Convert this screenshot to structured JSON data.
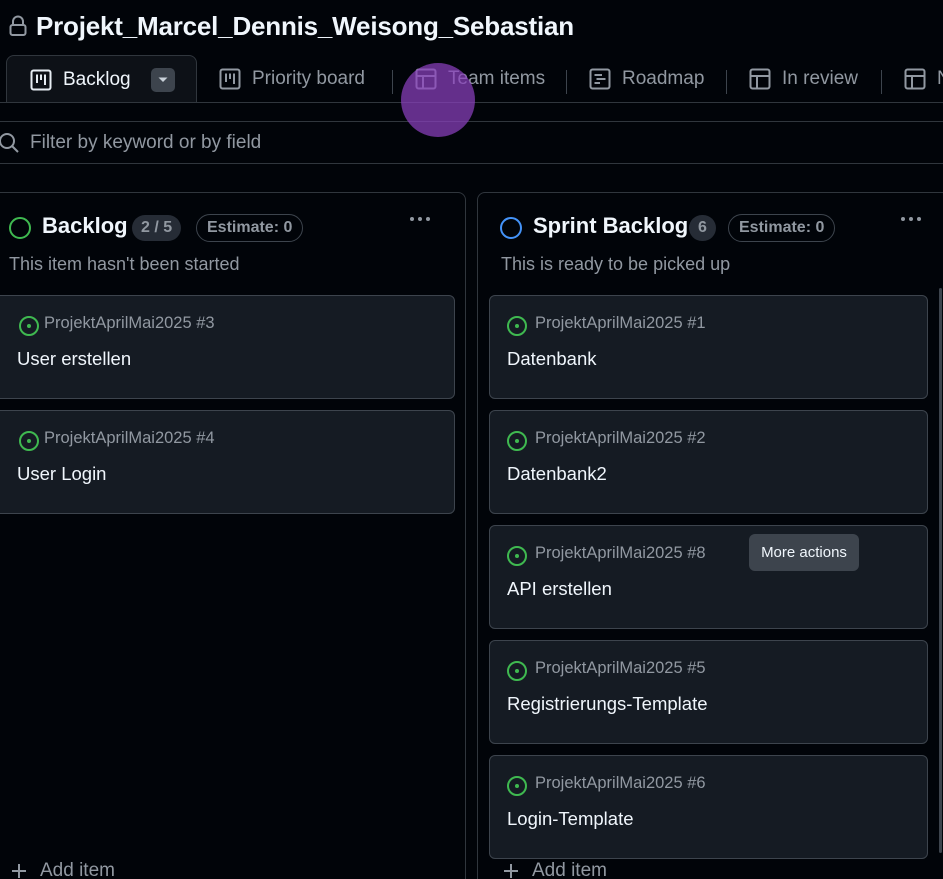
{
  "project": {
    "title": "Projekt_Marcel_Dennis_Weisong_Sebastian"
  },
  "tabs": [
    {
      "label": "Backlog",
      "icon": "board-icon",
      "active": true
    },
    {
      "label": "Priority board",
      "icon": "board-icon"
    },
    {
      "label": "Team items",
      "icon": "table-icon"
    },
    {
      "label": "Roadmap",
      "icon": "roadmap-icon"
    },
    {
      "label": "In review",
      "icon": "table-icon"
    },
    {
      "label": "N",
      "icon": "table-icon"
    }
  ],
  "filter": {
    "placeholder": "Filter by keyword or by field",
    "value": ""
  },
  "columns": [
    {
      "title": "Backlog",
      "count": "2 / 5",
      "estimate": "Estimate: 0",
      "description": "This item hasn't been started",
      "status_color": "#3fb950",
      "cards": [
        {
          "repo": "ProjektAprilMai2025 #3",
          "title": "User erstellen"
        },
        {
          "repo": "ProjektAprilMai2025 #4",
          "title": "User Login"
        }
      ],
      "add_item": "Add item"
    },
    {
      "title": "Sprint Backlog",
      "count": "6",
      "estimate": "Estimate: 0",
      "description": "This is ready to be picked up",
      "status_color": "#4493f8",
      "cards": [
        {
          "repo": "ProjektAprilMai2025 #1",
          "title": "Datenbank"
        },
        {
          "repo": "ProjektAprilMai2025 #2",
          "title": "Datenbank2"
        },
        {
          "repo": "ProjektAprilMai2025 #8",
          "title": "API erstellen"
        },
        {
          "repo": "ProjektAprilMai2025 #5",
          "title": "Registrierungs-Template"
        },
        {
          "repo": "ProjektAprilMai2025 #6",
          "title": "Login-Template"
        }
      ],
      "add_item": "Add item"
    }
  ],
  "tooltip": {
    "text": "More actions"
  },
  "colors": {
    "background": "#010409",
    "card": "#151b23",
    "border": "#3d444d",
    "text_muted": "#9198a1",
    "open_issue_green": "#3fb950",
    "sprint_blue": "#4493f8"
  }
}
